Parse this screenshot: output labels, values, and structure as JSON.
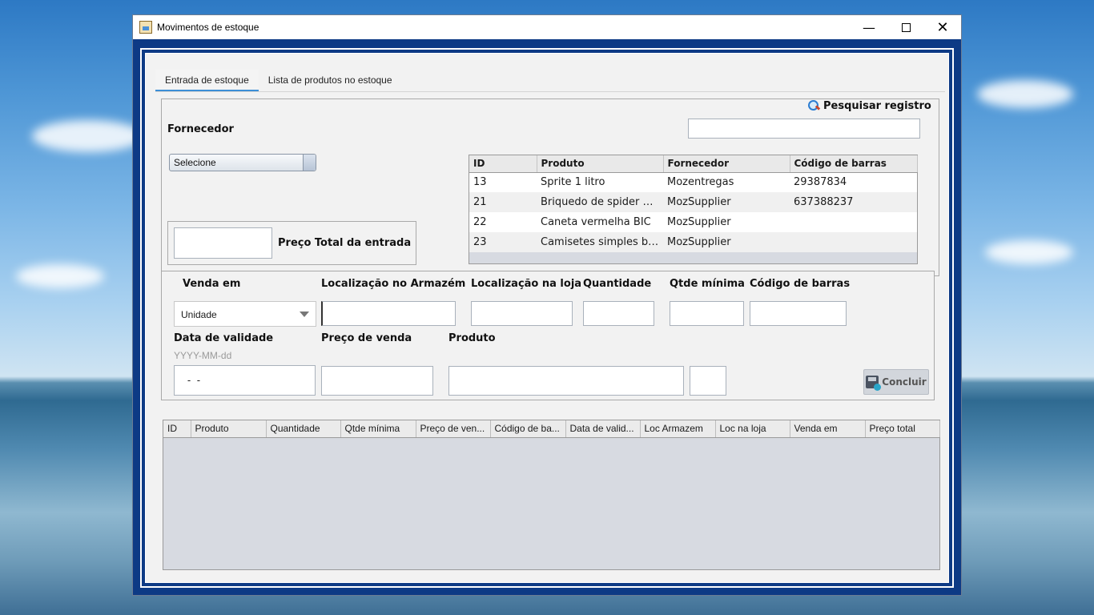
{
  "window": {
    "title": "Movimentos de estoque",
    "controls": {
      "minimize": "—",
      "close": "✕"
    }
  },
  "tabs": [
    {
      "label": "Entrada de estoque",
      "active": true
    },
    {
      "label": "Lista de produtos no estoque",
      "active": false
    }
  ],
  "search": {
    "label": "Pesquisar registro",
    "value": ""
  },
  "supplier": {
    "label": "Fornecedor",
    "select_value": "Selecione"
  },
  "total": {
    "label": "Preço Total da entrada",
    "value": ""
  },
  "products_table": {
    "columns": [
      "ID",
      "Produto",
      "Fornecedor",
      "Código de barras"
    ],
    "rows": [
      [
        "13",
        "Sprite 1 litro",
        "Mozentregas",
        "29387834"
      ],
      [
        "21",
        "Briquedo de spider man",
        "MozSupplier",
        "637388237"
      ],
      [
        "22",
        "Caneta vermelha BIC",
        "MozSupplier",
        ""
      ],
      [
        "23",
        "Camisetes simples bra...",
        "MozSupplier",
        ""
      ]
    ]
  },
  "form": {
    "venda_em": {
      "label": "Venda em",
      "value": "Unidade"
    },
    "loc_armazem": {
      "label": "Localização no Armazém",
      "value": ""
    },
    "loc_loja": {
      "label": "Localização na loja",
      "value": ""
    },
    "quantidade": {
      "label": "Quantidade",
      "value": ""
    },
    "qtde_minima": {
      "label": "Qtde mínima",
      "value": ""
    },
    "codigo_barras": {
      "label": "Código de barras",
      "value": ""
    },
    "data_validade": {
      "label": "Data de validade",
      "hint": "YYYY-MM-dd",
      "value": " -  -"
    },
    "preco_venda": {
      "label": "Preço de venda",
      "value": ""
    },
    "produto": {
      "label": "Produto",
      "value": "",
      "extra_value": ""
    },
    "concluir_label": "Concluir"
  },
  "entries_table": {
    "columns": [
      "ID",
      "Produto",
      "Quantidade",
      "Qtde mínima",
      "Preço de ven...",
      "Código de ba...",
      "Data de valid...",
      "Loc Armazem",
      "Loc na loja",
      "Venda em",
      "Preço total"
    ]
  }
}
